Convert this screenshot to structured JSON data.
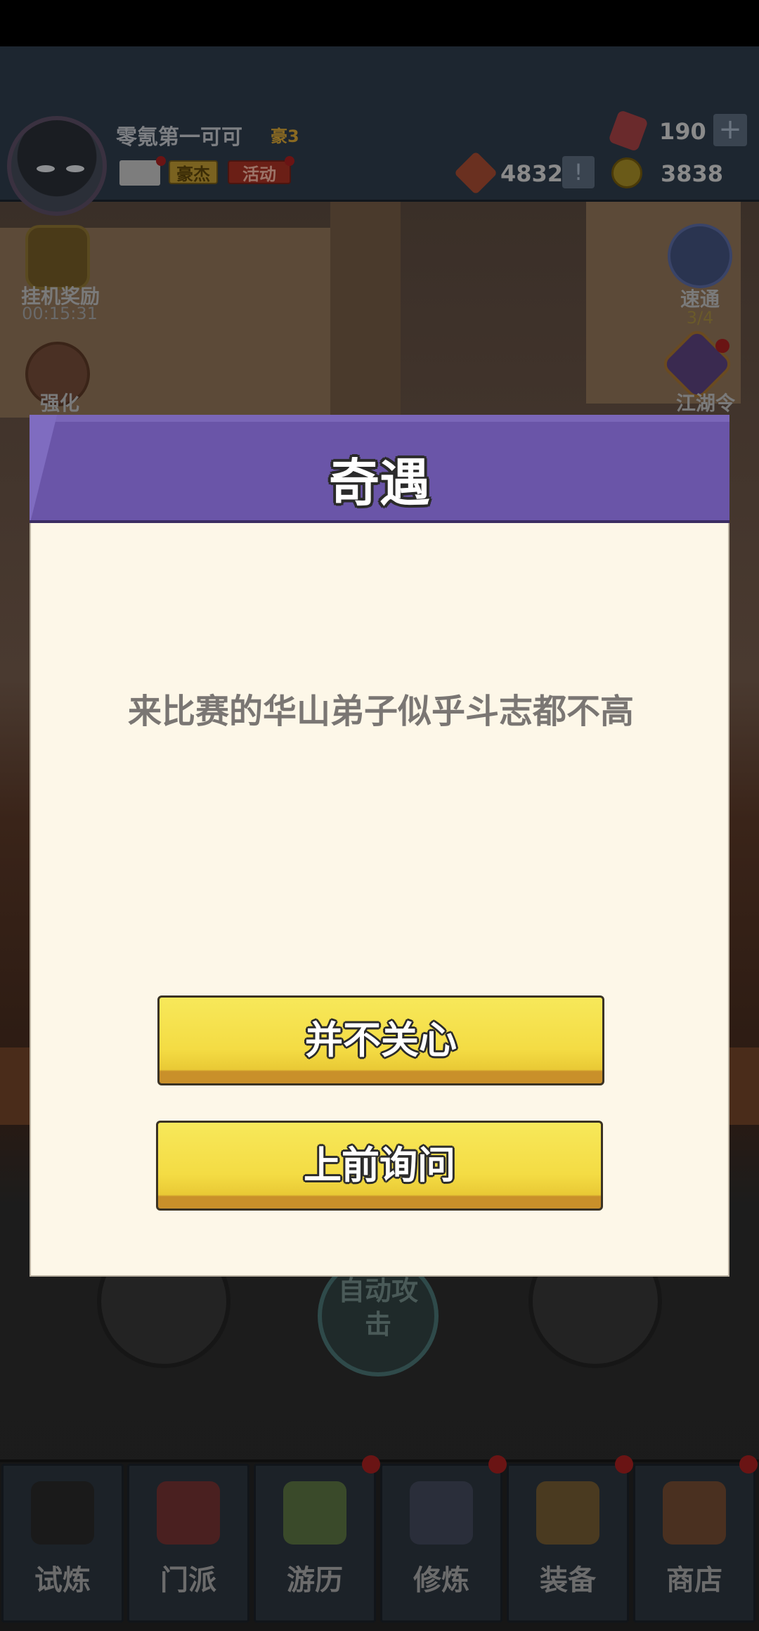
{
  "player": {
    "name": "零氪第一可可",
    "rank": "豪3",
    "hero_label": "豪杰",
    "event_label": "活动"
  },
  "resources": {
    "gems": "190",
    "tokens": "4832",
    "coins": "3838"
  },
  "side_menu": {
    "idle_reward": "挂机奖励",
    "idle_timer": "00:15:31",
    "enhance": "强化",
    "sweep": "速通",
    "sweep_count": "3/4",
    "jianghu": "江湖令"
  },
  "controls": {
    "auto_attack": "自动攻击"
  },
  "bottom_nav": [
    {
      "label": "试炼",
      "icon": "ninja-icon"
    },
    {
      "label": "门派",
      "icon": "temple-icon"
    },
    {
      "label": "游历",
      "icon": "landscape-icon"
    },
    {
      "label": "修炼",
      "icon": "scroll-book-icon"
    },
    {
      "label": "装备",
      "icon": "sword-icon"
    },
    {
      "label": "商店",
      "icon": "shop-icon"
    }
  ],
  "dialog": {
    "title": "奇遇",
    "message": "来比赛的华山弟子似乎斗志都不高",
    "choices": [
      "并不关心",
      "上前询问"
    ]
  }
}
